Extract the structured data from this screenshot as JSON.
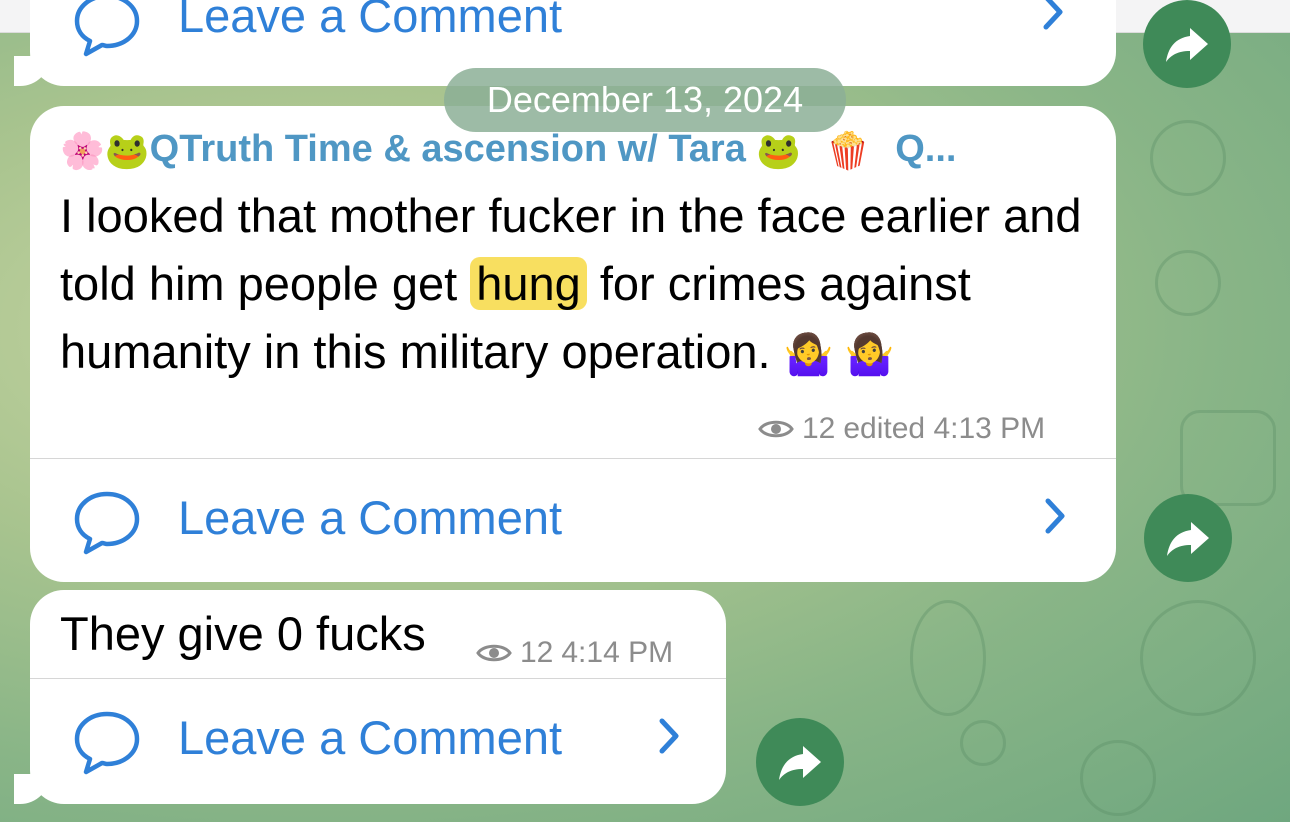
{
  "previous_message": {
    "comment_label": "Leave a Comment"
  },
  "date_separator": "December 13, 2024",
  "main_message": {
    "author_emoji_1": "🌸",
    "author_emoji_2": "🐸",
    "author_name": "QTruth Time & ascension w/ Tara",
    "author_emoji_3": "🐸",
    "author_emoji_4": "🍿",
    "author_suffix": "Q...",
    "text_part_1": "I looked that mother fucker in the face earlier and told him people get",
    "highlighted_word": "hung",
    "text_part_2": "for crimes against humanity in this military operation.",
    "text_emojis": "🤷‍♀️ 🤷‍♀️",
    "views": "12",
    "meta_status": "edited 4:13 PM",
    "comment_label": "Leave a Comment"
  },
  "reply_message": {
    "text": "They give 0 fucks",
    "views": "12",
    "time": "4:14 PM",
    "comment_label": "Leave a Comment"
  },
  "icons": {
    "comment": "speech-bubble-icon",
    "chevron": "chevron-right-icon",
    "views": "eye-icon",
    "share": "share-arrow-icon"
  },
  "colors": {
    "accent_blue": "#2f80d8",
    "author_blue": "#4f97c4",
    "highlight": "#f8df60",
    "share_green": "#3f8a58"
  }
}
